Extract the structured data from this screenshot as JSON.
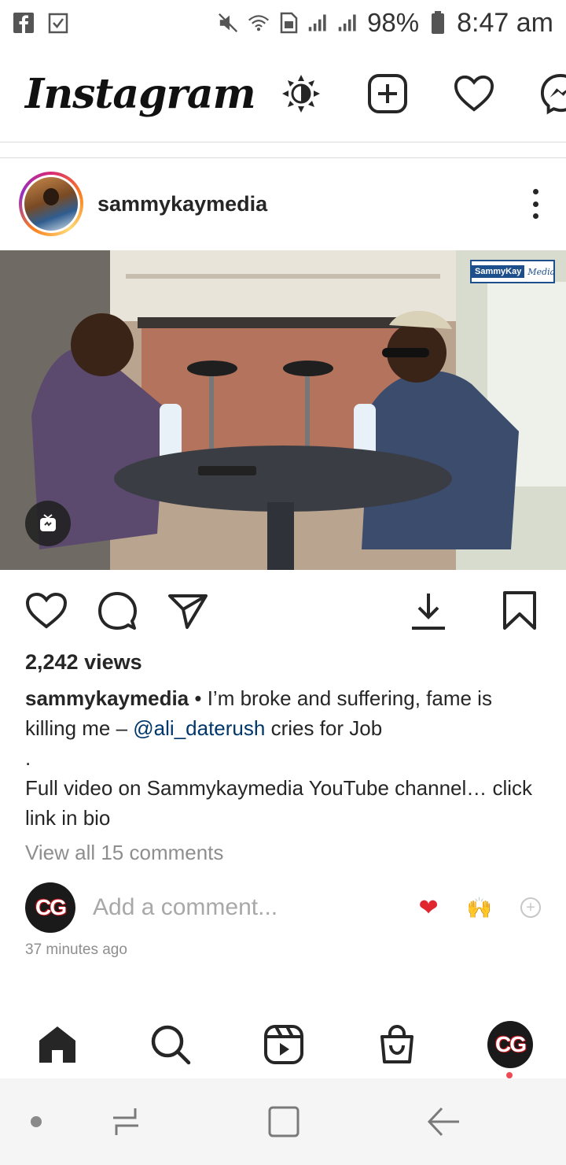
{
  "status_bar": {
    "left_icons": [
      "facebook-icon",
      "checkbox-icon"
    ],
    "right_icons": [
      "mute-icon",
      "wifi-icon",
      "sim-icon",
      "signal-icon",
      "signal-icon"
    ],
    "battery": "98%",
    "time": "8:47 am"
  },
  "header": {
    "logo": "Instagram",
    "icons": [
      "brightness-icon",
      "new-post-icon",
      "activity-heart-icon",
      "messenger-icon"
    ]
  },
  "post": {
    "username": "sammykaymedia",
    "watermark_a": "SammyKay",
    "watermark_b": "Media",
    "views": "2,242 views",
    "caption_user": "sammykaymedia",
    "caption_part1": " • I’m broke and suffering, fame is killing me – ",
    "mention": "@ali_daterush",
    "caption_part2": " cries for Job",
    "caption_dot": ".",
    "caption_line2": "Full video on Sammykaymedia YouTube channel… click link in bio",
    "view_comments": "View all 15 comments",
    "add_comment_placeholder": "Add a comment...",
    "comment_avatar_text": "CG",
    "quick_emoji_1": "❤",
    "quick_emoji_2": "🙌",
    "plus": "+",
    "timestamp": "37 minutes ago"
  },
  "bottom_nav": {
    "items": [
      "home-icon",
      "search-icon",
      "reels-icon",
      "shop-icon",
      "profile-avatar"
    ],
    "profile_text": "CG"
  },
  "colors": {
    "mention": "#00376b",
    "muted": "#8e8e8e",
    "notification_dot": "#ed4956"
  }
}
